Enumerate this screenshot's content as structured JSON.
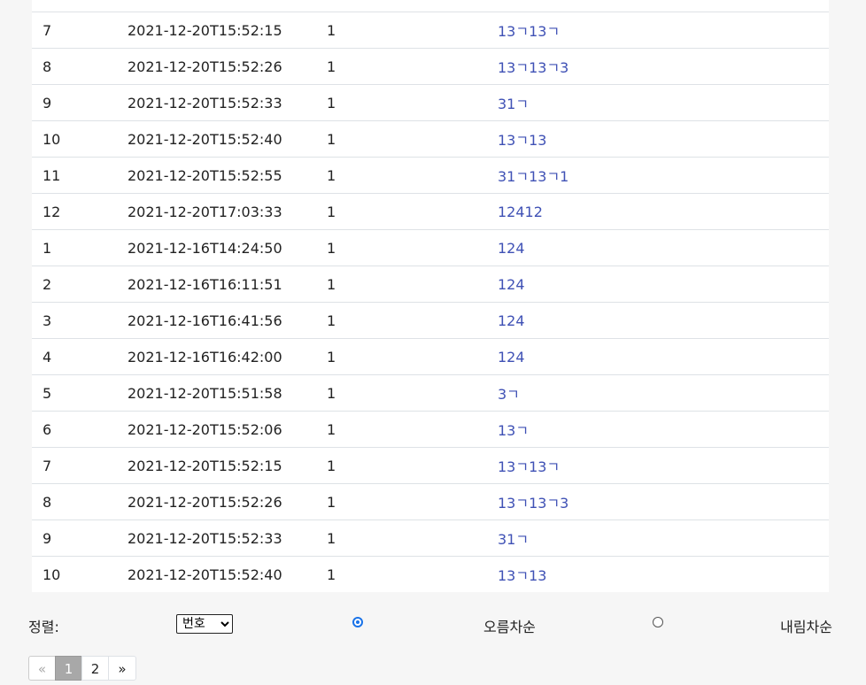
{
  "table": {
    "rows": [
      {
        "no": "7",
        "date": "2021-12-20T15:52:15",
        "count": "1",
        "title": "13ㄱ13ㄱ"
      },
      {
        "no": "8",
        "date": "2021-12-20T15:52:26",
        "count": "1",
        "title": "13ㄱ13ㄱ3"
      },
      {
        "no": "9",
        "date": "2021-12-20T15:52:33",
        "count": "1",
        "title": "31ㄱ"
      },
      {
        "no": "10",
        "date": "2021-12-20T15:52:40",
        "count": "1",
        "title": "13ㄱ13"
      },
      {
        "no": "11",
        "date": "2021-12-20T15:52:55",
        "count": "1",
        "title": "31ㄱ13ㄱ1"
      },
      {
        "no": "12",
        "date": "2021-12-20T17:03:33",
        "count": "1",
        "title": "12412"
      },
      {
        "no": "1",
        "date": "2021-12-16T14:24:50",
        "count": "1",
        "title": "124"
      },
      {
        "no": "2",
        "date": "2021-12-16T16:11:51",
        "count": "1",
        "title": "124"
      },
      {
        "no": "3",
        "date": "2021-12-16T16:41:56",
        "count": "1",
        "title": "124"
      },
      {
        "no": "4",
        "date": "2021-12-16T16:42:00",
        "count": "1",
        "title": "124"
      },
      {
        "no": "5",
        "date": "2021-12-20T15:51:58",
        "count": "1",
        "title": "3ㄱ"
      },
      {
        "no": "6",
        "date": "2021-12-20T15:52:06",
        "count": "1",
        "title": "13ㄱ"
      },
      {
        "no": "7",
        "date": "2021-12-20T15:52:15",
        "count": "1",
        "title": "13ㄱ13ㄱ"
      },
      {
        "no": "8",
        "date": "2021-12-20T15:52:26",
        "count": "1",
        "title": "13ㄱ13ㄱ3"
      },
      {
        "no": "9",
        "date": "2021-12-20T15:52:33",
        "count": "1",
        "title": "31ㄱ"
      },
      {
        "no": "10",
        "date": "2021-12-20T15:52:40",
        "count": "1",
        "title": "13ㄱ13"
      }
    ]
  },
  "sort": {
    "label": "정렬:",
    "selected": "번호",
    "options": [
      "번호"
    ],
    "asc_label": "오름차순",
    "desc_label": "내림차순",
    "order": "asc"
  },
  "pagination": {
    "prev": "«",
    "pages": [
      "1",
      "2"
    ],
    "current": "1",
    "next": "»"
  },
  "colors": {
    "link": "#3f51b5",
    "radio_accent": "#1a73e8",
    "active_page_bg": "#a8a8a8"
  }
}
